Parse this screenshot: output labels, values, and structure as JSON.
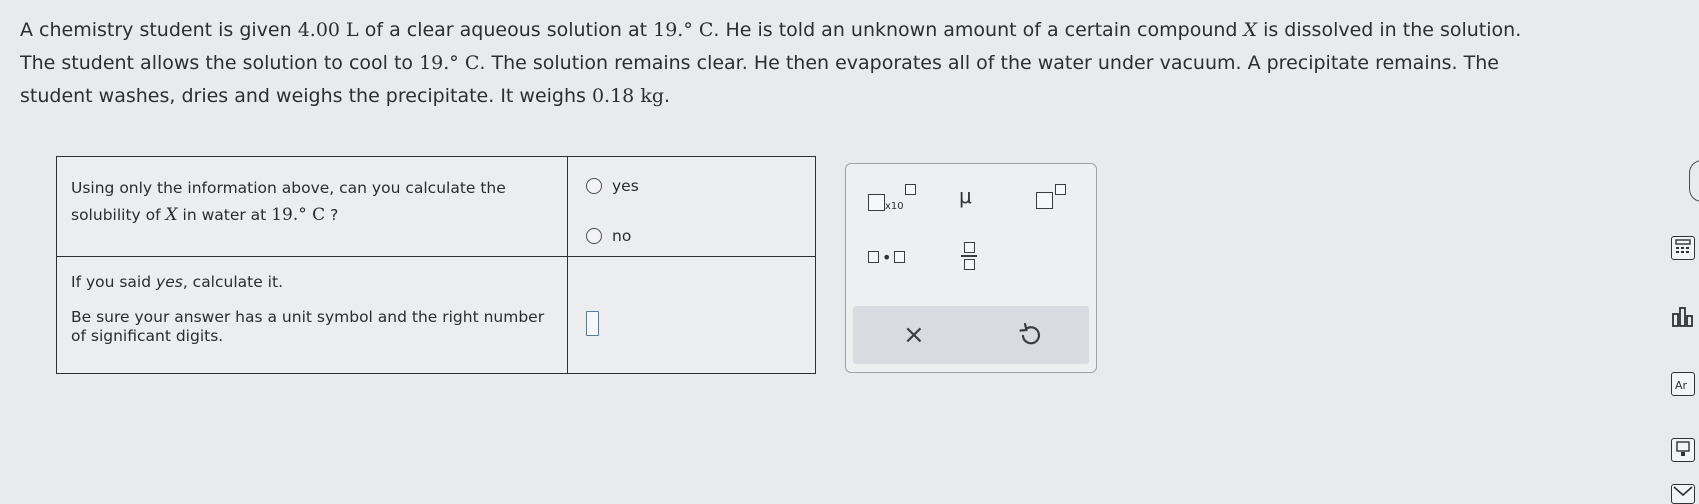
{
  "problem": {
    "line1_a": "A chemistry student is given ",
    "line1_vol": "4.00 L",
    "line1_b": " of a clear aqueous solution at ",
    "line1_temp": "19.° C",
    "line1_c": ". He is told an unknown amount of a certain compound ",
    "line1_x": "X",
    "line1_d": " is dissolved in the solution.",
    "line2_a": "The student allows the solution to cool to ",
    "line2_temp": "19.° C",
    "line2_b": ". The solution remains clear. He then evaporates all of the water under vacuum. A precipitate remains. The",
    "line3_a": "student washes, dries and weighs the precipitate. It weighs ",
    "line3_mass": "0.18 kg",
    "line3_b": "."
  },
  "question1": {
    "text_a": "Using only the information above, can you calculate the solubility of ",
    "x": "X",
    "text_b": " in water at ",
    "temp": "19.° C",
    "text_c": " ?",
    "option_yes": "yes",
    "option_no": "no"
  },
  "question2": {
    "line1_a": "If you said ",
    "line1_yes": "yes",
    "line1_b": ", calculate it.",
    "line2": "Be sure your answer has a unit symbol and the right number of significant digits."
  },
  "palette": {
    "x10_label": "x10",
    "mu_label": "μ",
    "clear_symbol": "×"
  },
  "colors": {
    "background": "#e9eaec",
    "answer_box_border": "#5a7aa5",
    "palette_bar": "#d8dbe0"
  },
  "icons": {
    "undo": "undo-icon",
    "calculator": "calculator-icon",
    "chart": "chart-icon",
    "periodic_table": "periodic-table-icon",
    "reference": "reference-icon",
    "mail": "mail-icon"
  }
}
